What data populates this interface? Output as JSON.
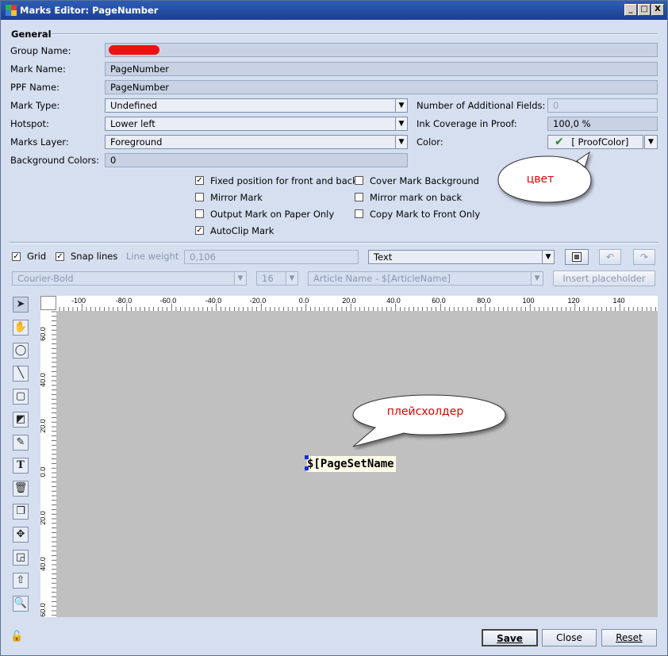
{
  "window": {
    "title": "Marks Editor: PageNumber",
    "btn_min": "_",
    "btn_max": "□",
    "btn_close": "X"
  },
  "general": {
    "section_title": "General",
    "group_name_label": "Group Name:",
    "group_name_value": "",
    "mark_name_label": "Mark Name:",
    "mark_name_value": "PageNumber",
    "ppf_name_label": "PPF Name:",
    "ppf_name_value": "PageNumber",
    "mark_type_label": "Mark Type:",
    "mark_type_value": "Undefined",
    "hotspot_label": "Hotspot:",
    "hotspot_value": "Lower left",
    "marks_layer_label": "Marks Layer:",
    "marks_layer_value": "Foreground",
    "bg_colors_label": "Background Colors:",
    "bg_colors_value": "0",
    "add_fields_label": "Number of Additional Fields:",
    "add_fields_value": "0",
    "ink_label": "Ink Coverage in Proof:",
    "ink_value": "100,0 %",
    "color_label": "Color:",
    "color_value": "[ ProofColor]"
  },
  "checkboxes": [
    {
      "label": "Fixed position for front and back",
      "checked": true
    },
    {
      "label": "Cover Mark Background",
      "checked": false
    },
    {
      "label": "Mirror Mark",
      "checked": false
    },
    {
      "label": "Mirror mark on back",
      "checked": false
    },
    {
      "label": "Output Mark on Paper Only",
      "checked": false
    },
    {
      "label": "Copy Mark to Front Only",
      "checked": false
    },
    {
      "label": "AutoClip Mark",
      "checked": true
    }
  ],
  "toolbar": {
    "grid_label": "Grid",
    "snap_label": "Snap lines",
    "line_weight_label": "Line weight",
    "line_weight_value": "0,106",
    "object_type": "Text",
    "font": "Courier-Bold",
    "font_size": "16",
    "placeholder": "Article Name - $[ArticleName]",
    "insert_placeholder": "Insert placeholder"
  },
  "ruler": {
    "h_ticks": [
      "-100",
      "-80.0",
      "-60.0",
      "-40.0",
      "-20.0",
      "0.0",
      "20.0",
      "40.0",
      "60.0",
      "80.0",
      "100",
      "120",
      "140"
    ],
    "v_ticks": [
      "60.0",
      "40.0",
      "20.0",
      "0.0",
      "20.0",
      "40.0",
      "60.0"
    ]
  },
  "canvas": {
    "text": "$[PageSetName"
  },
  "callouts": {
    "color": "цвет",
    "placeholder": "плейсхолдер"
  },
  "footer": {
    "save": "Save",
    "close": "Close",
    "reset": "Reset"
  }
}
